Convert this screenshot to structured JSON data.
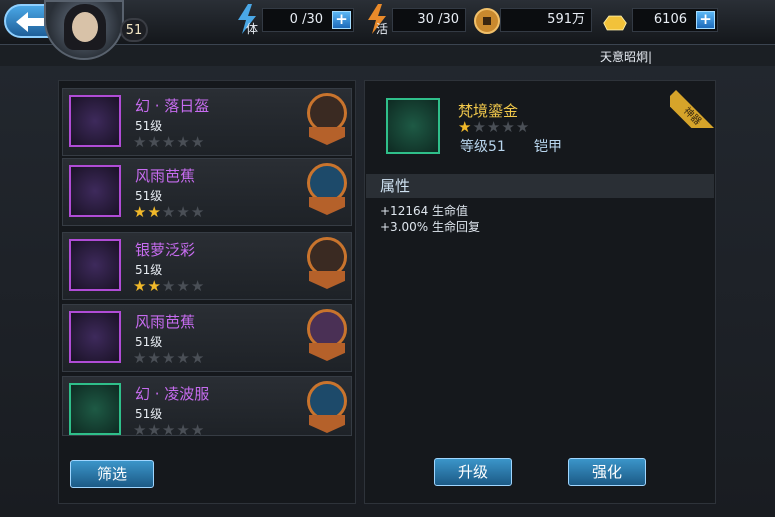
{
  "header": {
    "player_level": "51",
    "stamina": {
      "tag": "体",
      "value": "0 /30"
    },
    "energy": {
      "tag": "活",
      "value": "30 /30"
    },
    "copper": {
      "value": "591万"
    },
    "gold": {
      "value": "6106"
    },
    "subtitle": "天意昭炯|"
  },
  "items": [
    {
      "name": "幻 · 落日盔",
      "level": "51级",
      "stars_on": 0
    },
    {
      "name": "风雨芭蕉",
      "level": "51级",
      "stars_on": 2
    },
    {
      "name": "银萝泛彩",
      "level": "51级",
      "stars_on": 2
    },
    {
      "name": "风雨芭蕉",
      "level": "51级",
      "stars_on": 0
    },
    {
      "name": "幻 · 凌波服",
      "level": "51级",
      "stars_on": 0
    }
  ],
  "buttons": {
    "filter": "筛选",
    "upgrade": "升级",
    "enhance": "强化"
  },
  "detail": {
    "name": "梵境鎏金",
    "stars_on": 1,
    "level": "等级51",
    "type": "铠甲",
    "tag": "神器",
    "attr_title": "属性",
    "attrs": [
      "+12164 生命值",
      "+3.00% 生命回复"
    ]
  },
  "colors": {
    "accent": "#3b95c9",
    "purple_name": "#c76cf0",
    "gold_name": "#f1c84b",
    "star": "#f1b92a"
  }
}
